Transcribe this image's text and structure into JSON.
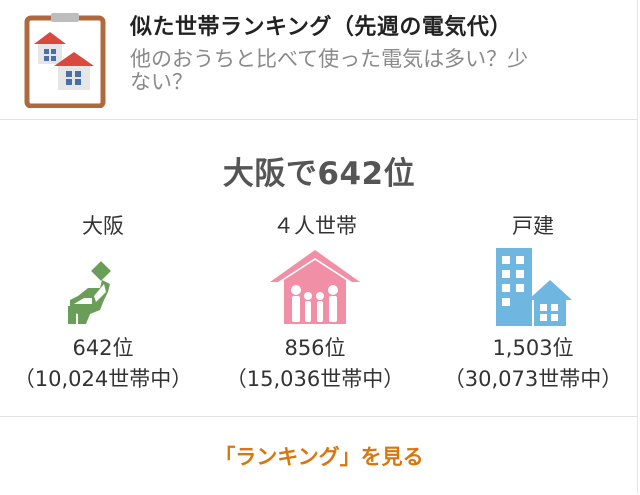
{
  "header": {
    "title": "似た世帯ランキング（先週の電気代）",
    "subtitle": "他のおうちと比べて使った電気は多い？少ない？",
    "icon": "houses-clipboard-icon"
  },
  "main": {
    "headline": "大阪で642位",
    "columns": [
      {
        "label": "大阪",
        "icon": "osaka-map-icon",
        "rank": "642位",
        "total": "（10,024世帯中）",
        "color": "#6a9e58"
      },
      {
        "label": "４人世帯",
        "icon": "family-house-icon",
        "rank": "856位",
        "total": "（15,036世帯中）",
        "color": "#f08fa6"
      },
      {
        "label": "戸建",
        "icon": "buildings-icon",
        "rank": "1,503位",
        "total": "（30,073世帯中）",
        "color": "#6fb7e0"
      }
    ]
  },
  "footer": {
    "link_label": "「ランキング」を見る",
    "link_color": "#d9760f"
  },
  "colors": {
    "clipboard": "#b0683e",
    "roof": "#d84a3e"
  }
}
